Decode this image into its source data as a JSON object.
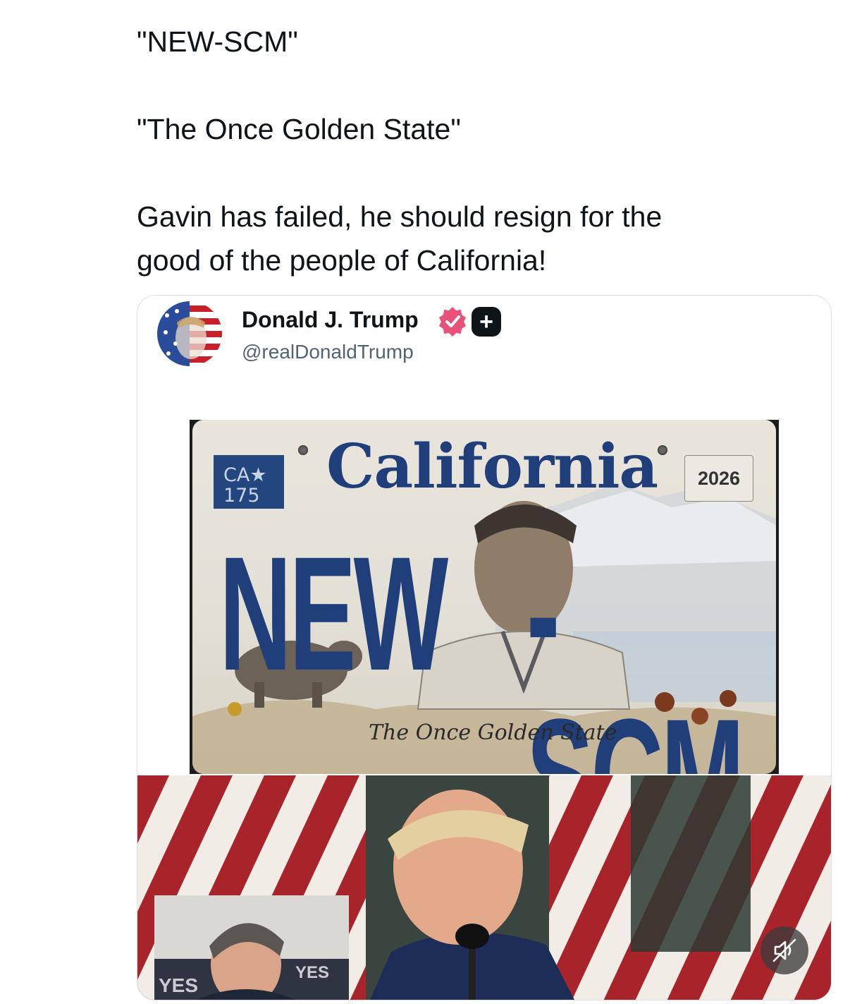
{
  "post": {
    "lines": [
      "\"NEW-SCM\"",
      "\"The Once Golden State\"",
      "Gavin has failed, he should resign for the",
      "good of the people of California!"
    ]
  },
  "quote": {
    "author_name": "Donald J. Trump",
    "author_handle": "@realDonaldTrump",
    "verified_icon": "verified-badge-icon",
    "affiliate_icon": "plus-badge-icon",
    "plus_glyph": "+"
  },
  "plate": {
    "state": "California",
    "ca_line1": "CA★",
    "ca_line2": "175",
    "year": "2026",
    "number_left": "NEW",
    "number_right": "-SCM",
    "slogan": "The Once Golden State"
  },
  "video": {
    "inset_sign_left": "YES",
    "inset_sign_right": "YES",
    "mute_icon": "muted-speaker-icon"
  },
  "colors": {
    "text": "#0f1419",
    "muted": "#536471",
    "plate_blue": "#1f3e7a",
    "verified_pink": "#e8517a"
  }
}
